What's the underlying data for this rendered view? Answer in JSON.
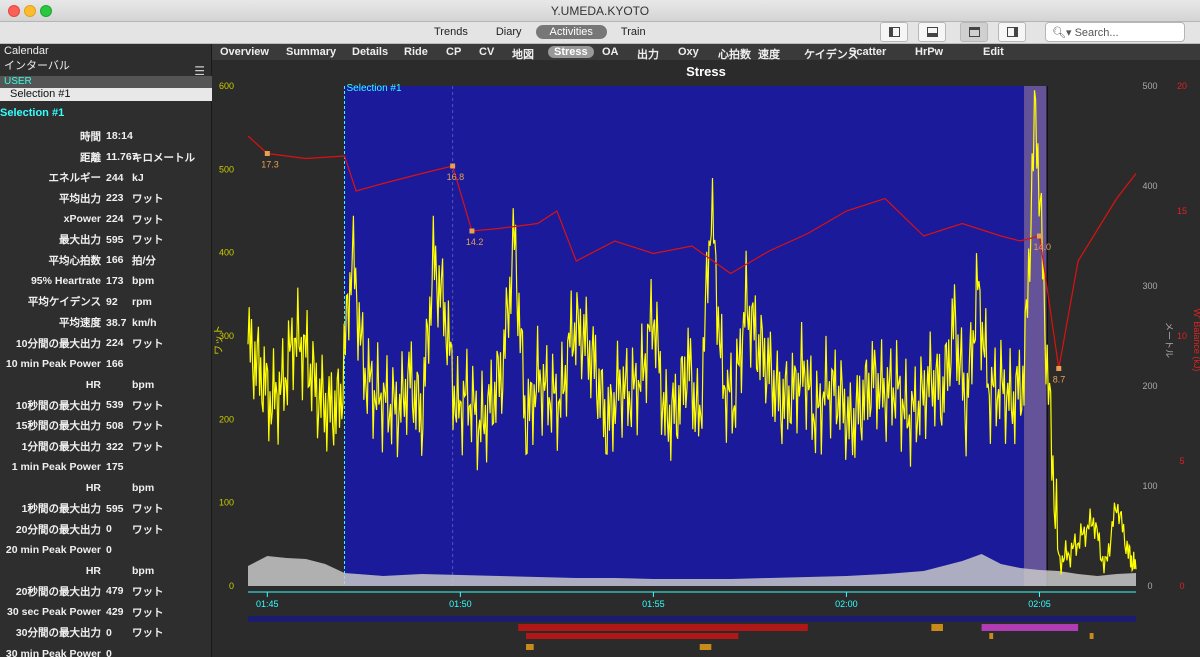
{
  "window": {
    "title": "Y.UMEDA.KYOTO"
  },
  "top_tabs": [
    {
      "label": "Trends",
      "active": false
    },
    {
      "label": "Diary",
      "active": false
    },
    {
      "label": "Activities",
      "active": true
    },
    {
      "label": "Train",
      "active": false
    }
  ],
  "search": {
    "placeholder": "Search..."
  },
  "sidebar": {
    "calendar_label": "Calendar",
    "interval_label": "インターバル",
    "user_label": "USER",
    "selection_item": "Selection #1",
    "selection_title": "Selection #1",
    "metrics": [
      {
        "label": "時間",
        "value": "18:14",
        "unit": ""
      },
      {
        "label": "距離",
        "value": "11.767",
        "unit": "キロメートル"
      },
      {
        "label": "エネルギー",
        "value": "244",
        "unit": "kJ"
      },
      {
        "label": "平均出力",
        "value": "223",
        "unit": "ワット"
      },
      {
        "label": "xPower",
        "value": "224",
        "unit": "ワット"
      },
      {
        "label": "最大出力",
        "value": "595",
        "unit": "ワット"
      },
      {
        "label": "平均心拍数",
        "value": "166",
        "unit": "拍/分"
      },
      {
        "label": "95% Heartrate",
        "value": "173",
        "unit": "bpm"
      },
      {
        "label": "平均ケイデンス",
        "value": "92",
        "unit": "rpm"
      },
      {
        "label": "平均速度",
        "value": "38.7",
        "unit": "km/h"
      },
      {
        "label": "10分間の最大出力",
        "value": "224",
        "unit": "ワット"
      },
      {
        "label": "10 min Peak Power",
        "value": "166",
        "unit": ""
      },
      {
        "label": "HR",
        "value": "",
        "unit": "bpm"
      },
      {
        "label": "10秒間の最大出力",
        "value": "539",
        "unit": "ワット"
      },
      {
        "label": "15秒間の最大出力",
        "value": "508",
        "unit": "ワット"
      },
      {
        "label": "1分間の最大出力",
        "value": "322",
        "unit": "ワット"
      },
      {
        "label": "1 min Peak Power",
        "value": "175",
        "unit": ""
      },
      {
        "label": "HR",
        "value": "",
        "unit": "bpm"
      },
      {
        "label": "1秒間の最大出力",
        "value": "595",
        "unit": "ワット"
      },
      {
        "label": "20分間の最大出力",
        "value": "0",
        "unit": "ワット"
      },
      {
        "label": "20 min Peak Power",
        "value": "0",
        "unit": ""
      },
      {
        "label": "HR",
        "value": "",
        "unit": "bpm"
      },
      {
        "label": "20秒間の最大出力",
        "value": "479",
        "unit": "ワット"
      },
      {
        "label": "30 sec Peak Power",
        "value": "429",
        "unit": "ワット"
      },
      {
        "label": "30分間の最大出力",
        "value": "0",
        "unit": "ワット"
      },
      {
        "label": "30 min Peak Power",
        "value": "0",
        "unit": ""
      }
    ]
  },
  "view_tabs": [
    {
      "label": "Overview",
      "active": false
    },
    {
      "label": "Summary",
      "active": false
    },
    {
      "label": "Details",
      "active": false
    },
    {
      "label": "Ride",
      "active": false
    },
    {
      "label": "CP",
      "active": false
    },
    {
      "label": "CV",
      "active": false
    },
    {
      "label": "地図",
      "active": false
    },
    {
      "label": "Stress",
      "active": true
    },
    {
      "label": "OA",
      "active": false
    },
    {
      "label": "出力",
      "active": false
    },
    {
      "label": "Oxy",
      "active": false
    },
    {
      "label": "心拍数",
      "active": false
    },
    {
      "label": "速度",
      "active": false
    },
    {
      "label": "ケイデンス",
      "active": false
    },
    {
      "label": "Scatter",
      "active": false
    },
    {
      "label": "HrPw",
      "active": false
    },
    {
      "label": "Edit",
      "active": false
    }
  ],
  "colors": {
    "power": "#ffff00",
    "w_balance": "#dd1111",
    "selection_fill": "#1a1a9a",
    "altitude": "#c8c8c8",
    "accent_cyan": "#33ffff",
    "y_left_label": "#cccc00",
    "y_right_red": "#dd2222"
  },
  "chart_data": {
    "type": "line",
    "title": "Stress",
    "ylabel_left": "ワット",
    "ylabel_right_altitude": "メートル",
    "ylabel_right_wbal": "W' Balance (kJ)",
    "ylim_left": [
      0,
      600
    ],
    "ylim_right_altitude": [
      0,
      500
    ],
    "ylim_right_wbal": [
      0,
      20
    ],
    "yticks_left": [
      "0",
      "100",
      "200",
      "300",
      "400",
      "500",
      "600"
    ],
    "yticks_right_altitude": [
      "0",
      "100",
      "200",
      "300",
      "400",
      "500"
    ],
    "yticks_right_wbal": [
      "0",
      "5",
      "10",
      "15",
      "20"
    ],
    "x_ticks": [
      "01:45",
      "01:50",
      "01:55",
      "02:00",
      "02:05"
    ],
    "x_range_min": [
      104.5,
      127.5
    ],
    "selection": {
      "label": "Selection #1",
      "start_min": 107.0,
      "end_min": 125.2
    },
    "w_balance_annotations": [
      {
        "label": "17.3",
        "x_min": 105.0,
        "value": 17.3
      },
      {
        "label": "16.8",
        "x_min": 109.8,
        "value": 16.8
      },
      {
        "label": "14.2",
        "x_min": 110.3,
        "value": 14.2
      },
      {
        "label": "14.0",
        "x_min": 125.0,
        "value": 14.0
      },
      {
        "label": "8.7",
        "x_min": 125.5,
        "value": 8.7
      }
    ],
    "w_balance_series": {
      "name": "W' Balance",
      "x": [
        104.5,
        105.0,
        106.0,
        107.0,
        107.3,
        108.0,
        109.0,
        109.8,
        110.3,
        111.0,
        112.0,
        112.5,
        113.0,
        114.0,
        115.0,
        116.0,
        117.0,
        118.0,
        119.0,
        120.0,
        121.0,
        122.0,
        123.0,
        124.0,
        124.5,
        125.0,
        125.5,
        126.0,
        127.0,
        127.5
      ],
      "y": [
        18.0,
        17.3,
        17.1,
        17.2,
        15.8,
        16.1,
        16.5,
        16.8,
        14.2,
        14.3,
        14.5,
        15.0,
        13.0,
        13.8,
        13.3,
        13.6,
        12.5,
        13.4,
        14.1,
        15.0,
        15.5,
        14.0,
        14.5,
        14.0,
        13.8,
        14.0,
        8.7,
        13.0,
        15.5,
        16.5
      ]
    },
    "power_series": {
      "name": "Power",
      "x": [
        104.5,
        104.8,
        105.1,
        105.4,
        105.7,
        106.0,
        106.3,
        106.6,
        106.9,
        107.2,
        107.5,
        107.8,
        108.1,
        108.4,
        108.7,
        109.0,
        109.3,
        109.6,
        109.9,
        110.2,
        110.5,
        110.8,
        111.1,
        111.4,
        111.7,
        112.0,
        112.3,
        112.6,
        112.9,
        113.2,
        113.5,
        113.8,
        114.1,
        114.4,
        114.7,
        115.0,
        115.3,
        115.6,
        115.9,
        116.2,
        116.5,
        116.8,
        117.1,
        117.4,
        117.7,
        118.0,
        118.3,
        118.6,
        118.9,
        119.2,
        119.5,
        119.8,
        120.1,
        120.4,
        120.7,
        121.0,
        121.3,
        121.6,
        121.9,
        122.2,
        122.5,
        122.8,
        123.1,
        123.4,
        123.7,
        124.0,
        124.3,
        124.6,
        124.9,
        125.2,
        125.5,
        125.8,
        126.1,
        126.4,
        126.7,
        127.0,
        127.3,
        127.5
      ],
      "y": [
        290,
        260,
        220,
        240,
        300,
        280,
        230,
        210,
        220,
        400,
        260,
        230,
        220,
        210,
        250,
        200,
        390,
        330,
        210,
        230,
        190,
        220,
        260,
        420,
        190,
        250,
        230,
        220,
        310,
        300,
        260,
        190,
        240,
        230,
        250,
        330,
        200,
        210,
        270,
        190,
        460,
        240,
        220,
        340,
        290,
        260,
        220,
        230,
        260,
        200,
        240,
        230,
        190,
        220,
        250,
        230,
        240,
        200,
        220,
        250,
        230,
        320,
        210,
        360,
        230,
        240,
        220,
        250,
        580,
        260,
        30,
        40,
        60,
        80,
        20,
        100,
        40,
        20
      ]
    },
    "altitude_series": {
      "name": "Altitude",
      "x": [
        104.5,
        105.0,
        105.5,
        106.0,
        106.5,
        107.0,
        108.0,
        109.0,
        110.0,
        111.0,
        112.0,
        113.0,
        114.0,
        115.0,
        116.0,
        117.0,
        118.0,
        119.0,
        120.0,
        121.0,
        122.0,
        123.0,
        123.5,
        124.0,
        124.5,
        125.0,
        125.5,
        126.0,
        126.5,
        127.0,
        127.5
      ],
      "y": [
        20,
        30,
        28,
        27,
        22,
        13,
        10,
        12,
        11,
        10,
        9,
        8,
        8,
        7,
        7,
        7,
        8,
        9,
        10,
        12,
        15,
        25,
        32,
        22,
        18,
        16,
        15,
        12,
        10,
        12,
        13
      ]
    },
    "interval_bars": [
      {
        "row": 0,
        "start_min": 104.5,
        "end_min": 127.5,
        "color": "#1c1c6e"
      },
      {
        "row": 1,
        "start_min": 111.5,
        "end_min": 119.0,
        "color": "#b01818"
      },
      {
        "row": 1,
        "start_min": 122.2,
        "end_min": 122.5,
        "color": "#c88a1a"
      },
      {
        "row": 1,
        "start_min": 123.5,
        "end_min": 126.0,
        "color": "#b23cb4"
      },
      {
        "row": 2,
        "start_min": 111.7,
        "end_min": 117.2,
        "color": "#b01818"
      },
      {
        "row": 2,
        "start_min": 123.7,
        "end_min": 123.8,
        "color": "#c88a1a"
      },
      {
        "row": 2,
        "start_min": 126.3,
        "end_min": 126.4,
        "color": "#c88a1a"
      },
      {
        "row": 3,
        "start_min": 111.7,
        "end_min": 111.9,
        "color": "#c88a1a"
      },
      {
        "row": 3,
        "start_min": 116.2,
        "end_min": 116.5,
        "color": "#c88a1a"
      }
    ]
  }
}
